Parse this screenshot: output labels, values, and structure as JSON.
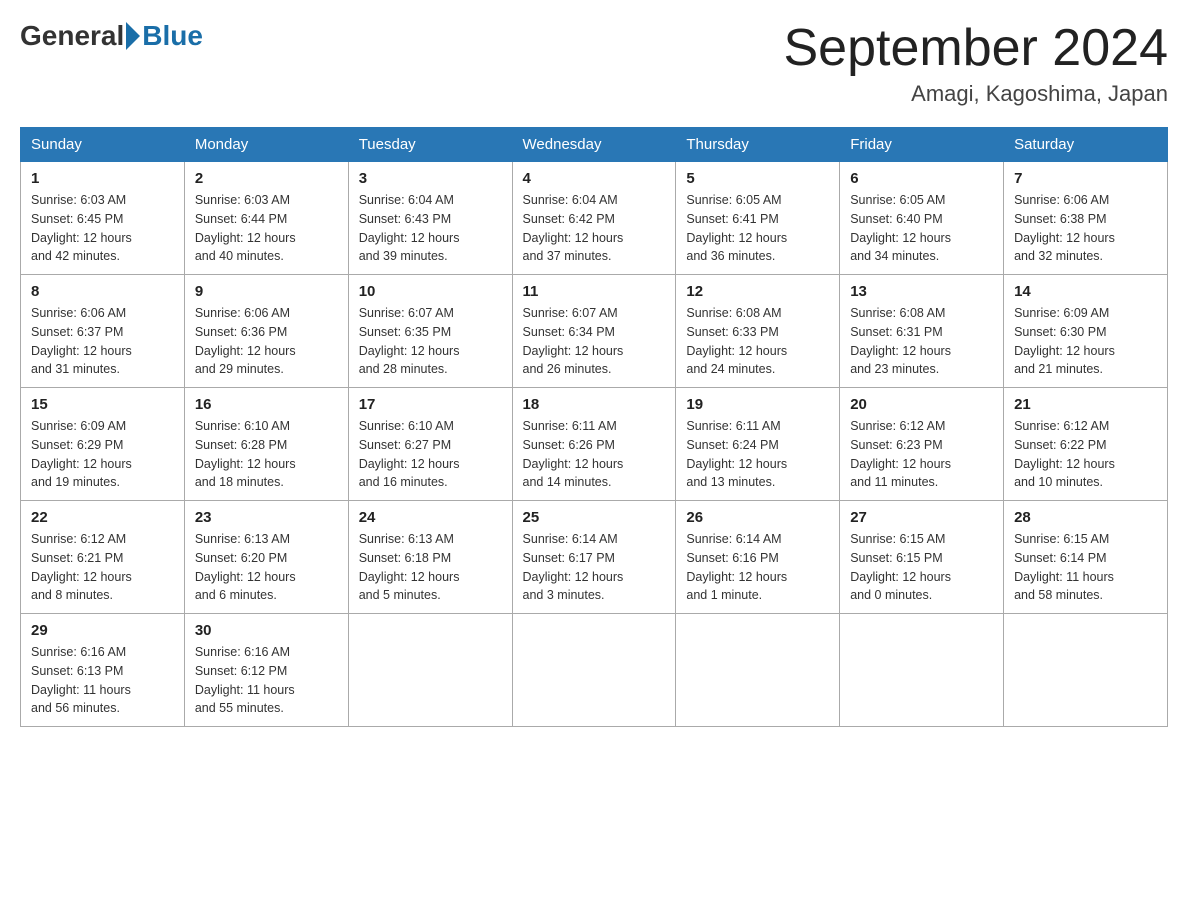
{
  "logo": {
    "general": "General",
    "blue": "Blue"
  },
  "title": "September 2024",
  "location": "Amagi, Kagoshima, Japan",
  "weekdays": [
    "Sunday",
    "Monday",
    "Tuesday",
    "Wednesday",
    "Thursday",
    "Friday",
    "Saturday"
  ],
  "weeks": [
    [
      {
        "day": "1",
        "sunrise": "6:03 AM",
        "sunset": "6:45 PM",
        "daylight": "12 hours and 42 minutes."
      },
      {
        "day": "2",
        "sunrise": "6:03 AM",
        "sunset": "6:44 PM",
        "daylight": "12 hours and 40 minutes."
      },
      {
        "day": "3",
        "sunrise": "6:04 AM",
        "sunset": "6:43 PM",
        "daylight": "12 hours and 39 minutes."
      },
      {
        "day": "4",
        "sunrise": "6:04 AM",
        "sunset": "6:42 PM",
        "daylight": "12 hours and 37 minutes."
      },
      {
        "day": "5",
        "sunrise": "6:05 AM",
        "sunset": "6:41 PM",
        "daylight": "12 hours and 36 minutes."
      },
      {
        "day": "6",
        "sunrise": "6:05 AM",
        "sunset": "6:40 PM",
        "daylight": "12 hours and 34 minutes."
      },
      {
        "day": "7",
        "sunrise": "6:06 AM",
        "sunset": "6:38 PM",
        "daylight": "12 hours and 32 minutes."
      }
    ],
    [
      {
        "day": "8",
        "sunrise": "6:06 AM",
        "sunset": "6:37 PM",
        "daylight": "12 hours and 31 minutes."
      },
      {
        "day": "9",
        "sunrise": "6:06 AM",
        "sunset": "6:36 PM",
        "daylight": "12 hours and 29 minutes."
      },
      {
        "day": "10",
        "sunrise": "6:07 AM",
        "sunset": "6:35 PM",
        "daylight": "12 hours and 28 minutes."
      },
      {
        "day": "11",
        "sunrise": "6:07 AM",
        "sunset": "6:34 PM",
        "daylight": "12 hours and 26 minutes."
      },
      {
        "day": "12",
        "sunrise": "6:08 AM",
        "sunset": "6:33 PM",
        "daylight": "12 hours and 24 minutes."
      },
      {
        "day": "13",
        "sunrise": "6:08 AM",
        "sunset": "6:31 PM",
        "daylight": "12 hours and 23 minutes."
      },
      {
        "day": "14",
        "sunrise": "6:09 AM",
        "sunset": "6:30 PM",
        "daylight": "12 hours and 21 minutes."
      }
    ],
    [
      {
        "day": "15",
        "sunrise": "6:09 AM",
        "sunset": "6:29 PM",
        "daylight": "12 hours and 19 minutes."
      },
      {
        "day": "16",
        "sunrise": "6:10 AM",
        "sunset": "6:28 PM",
        "daylight": "12 hours and 18 minutes."
      },
      {
        "day": "17",
        "sunrise": "6:10 AM",
        "sunset": "6:27 PM",
        "daylight": "12 hours and 16 minutes."
      },
      {
        "day": "18",
        "sunrise": "6:11 AM",
        "sunset": "6:26 PM",
        "daylight": "12 hours and 14 minutes."
      },
      {
        "day": "19",
        "sunrise": "6:11 AM",
        "sunset": "6:24 PM",
        "daylight": "12 hours and 13 minutes."
      },
      {
        "day": "20",
        "sunrise": "6:12 AM",
        "sunset": "6:23 PM",
        "daylight": "12 hours and 11 minutes."
      },
      {
        "day": "21",
        "sunrise": "6:12 AM",
        "sunset": "6:22 PM",
        "daylight": "12 hours and 10 minutes."
      }
    ],
    [
      {
        "day": "22",
        "sunrise": "6:12 AM",
        "sunset": "6:21 PM",
        "daylight": "12 hours and 8 minutes."
      },
      {
        "day": "23",
        "sunrise": "6:13 AM",
        "sunset": "6:20 PM",
        "daylight": "12 hours and 6 minutes."
      },
      {
        "day": "24",
        "sunrise": "6:13 AM",
        "sunset": "6:18 PM",
        "daylight": "12 hours and 5 minutes."
      },
      {
        "day": "25",
        "sunrise": "6:14 AM",
        "sunset": "6:17 PM",
        "daylight": "12 hours and 3 minutes."
      },
      {
        "day": "26",
        "sunrise": "6:14 AM",
        "sunset": "6:16 PM",
        "daylight": "12 hours and 1 minute."
      },
      {
        "day": "27",
        "sunrise": "6:15 AM",
        "sunset": "6:15 PM",
        "daylight": "12 hours and 0 minutes."
      },
      {
        "day": "28",
        "sunrise": "6:15 AM",
        "sunset": "6:14 PM",
        "daylight": "11 hours and 58 minutes."
      }
    ],
    [
      {
        "day": "29",
        "sunrise": "6:16 AM",
        "sunset": "6:13 PM",
        "daylight": "11 hours and 56 minutes."
      },
      {
        "day": "30",
        "sunrise": "6:16 AM",
        "sunset": "6:12 PM",
        "daylight": "11 hours and 55 minutes."
      },
      null,
      null,
      null,
      null,
      null
    ]
  ]
}
